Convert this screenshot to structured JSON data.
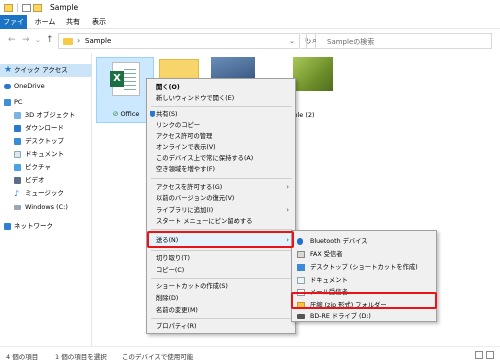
{
  "window": {
    "title": "Sample"
  },
  "ribbon": {
    "tabs": [
      "ファイル",
      "ホーム",
      "共有",
      "表示"
    ]
  },
  "address": {
    "path": "Sample"
  },
  "search": {
    "placeholder": "Sampleの検索"
  },
  "nav_pane": {
    "items": [
      {
        "label": "クイック アクセス",
        "icon": "star-icon"
      },
      {
        "label": "OneDrive",
        "icon": "cloud-icon"
      },
      {
        "label": "PC",
        "icon": "computer-icon"
      },
      {
        "label": "3D オブジェクト",
        "icon": "cube-icon"
      },
      {
        "label": "ダウンロード",
        "icon": "download-icon"
      },
      {
        "label": "デスクトップ",
        "icon": "desktop-icon"
      },
      {
        "label": "ドキュメント",
        "icon": "document-icon"
      },
      {
        "label": "ピクチャ",
        "icon": "picture-icon"
      },
      {
        "label": "ビデオ",
        "icon": "video-icon"
      },
      {
        "label": "ミュージック",
        "icon": "music-icon"
      },
      {
        "label": "Windows (C:)",
        "icon": "drive-icon"
      },
      {
        "label": "ネットワーク",
        "icon": "network-icon"
      }
    ]
  },
  "files": [
    {
      "name": "Office",
      "type": "excel",
      "selected": true,
      "synced": true
    },
    {
      "name": "mple (2)",
      "type": "photo"
    }
  ],
  "context_menu": {
    "groups": [
      [
        "開く(O)",
        "新しいウィンドウで開く(E)"
      ],
      [
        "共有(S)",
        "リンクのコピー",
        "アクセス許可の管理",
        "オンラインで表示(V)",
        "このデバイス上で常に保持する(A)",
        "空き領域を増やす(F)"
      ],
      [
        "アクセスを許可する(G)",
        "以前のバージョンの復元(V)",
        "ライブラリに追加(I)",
        "スタート メニューにピン留めする"
      ],
      [
        "送る(N)"
      ],
      [
        "切り取り(T)",
        "コピー(C)"
      ],
      [
        "ショートカットの作成(S)",
        "削除(D)",
        "名前の変更(M)"
      ],
      [
        "プロパティ(R)"
      ]
    ]
  },
  "send_to_menu": {
    "items": [
      {
        "label": "Bluetooth デバイス",
        "icon": "bluetooth-icon"
      },
      {
        "label": "FAX 受信者",
        "icon": "fax-icon"
      },
      {
        "label": "デスクトップ (ショートカットを作成)",
        "icon": "desktop-icon"
      },
      {
        "label": "ドキュメント",
        "icon": "document-icon"
      },
      {
        "label": "メール受信者",
        "icon": "mail-icon"
      },
      {
        "label": "圧縮 (zip 形式) フォルダー",
        "icon": "zip-folder-icon"
      },
      {
        "label": "BD-RE ドライブ (D:)",
        "icon": "disc-drive-icon"
      }
    ]
  },
  "status_bar": {
    "item_count": "4 個の項目",
    "selection": "1 個の項目を選択",
    "availability": "このデバイスで使用可能"
  },
  "colors": {
    "accent": "#1a73c5",
    "highlight_box": "#e8141a",
    "excel_green": "#1d7044",
    "selection": "#cce8ff"
  }
}
